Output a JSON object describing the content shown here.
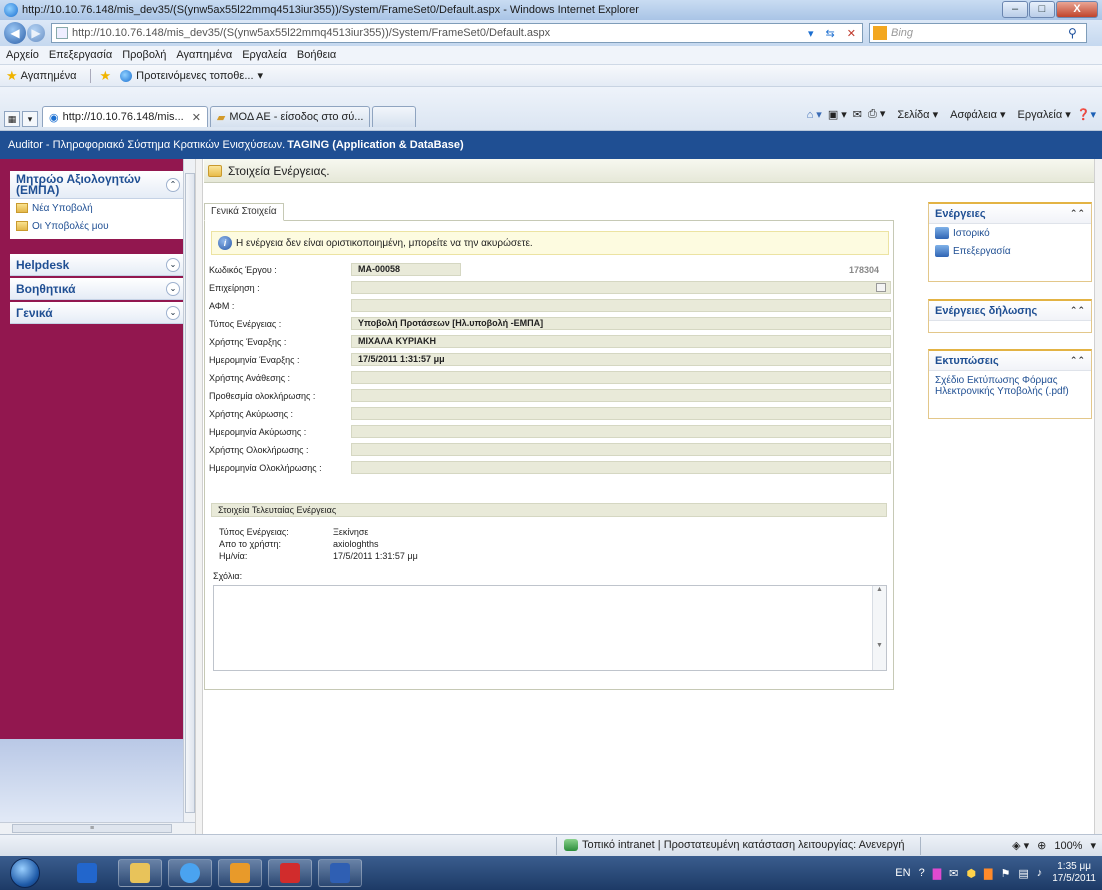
{
  "window": {
    "title": "http://10.10.76.148/mis_dev35/(S(ynw5ax55l22mmq4513iur355))/System/FrameSet0/Default.aspx - Windows Internet Explorer",
    "min": "‒",
    "max": "□",
    "close": "X"
  },
  "addressbar": {
    "url": "http://10.10.76.148/mis_dev35/(S(ynw5ax55l22mmq4513iur355))/System/FrameSet0/Default.aspx",
    "search_placeholder": "Bing"
  },
  "menubar": [
    "Αρχείο",
    "Επεξεργασία",
    "Προβολή",
    "Αγαπημένα",
    "Εργαλεία",
    "Βοήθεια"
  ],
  "favorites": {
    "label": "Αγαπημένα",
    "suggested": "Προτεινόμενες τοποθε..."
  },
  "tabs": [
    {
      "label": "http://10.10.76.148/mis..."
    },
    {
      "label": "ΜΟΔ ΑΕ - είσοδος στο σύ..."
    }
  ],
  "commandbar": {
    "page": "Σελίδα",
    "safety": "Ασφάλεια",
    "tools": "Εργαλεία"
  },
  "app": {
    "header_prefix": "Auditor - Πληροφοριακό Σύστημα Κρατικών Ενισχύσεων.",
    "header_bold": "TAGING (Application & DataBase)"
  },
  "sidebar": {
    "section1_title": "Μητρώο Αξιολογητών (ΕΜΠΑ)",
    "items": [
      "Νέα Υποβολή",
      "Οι Υποβολές μου"
    ],
    "helpdesk": "Helpdesk",
    "helpers": "Βοηθητικά",
    "general": "Γενικά"
  },
  "main": {
    "title": "Στοιχεία Ενέργειας.",
    "tab": "Γενικά Στοιχεία",
    "notice": "Η ενέργεια δεν είναι οριστικοποιημένη, μπορείτε να την ακυρώσετε.",
    "fields": [
      {
        "label": "Κωδικός Έργου :",
        "value": "MA-00058"
      },
      {
        "label": "Επιχείρηση :",
        "value": ""
      },
      {
        "label": "ΑΦΜ :",
        "value": ""
      },
      {
        "label": "Τύπος Ενέργειας :",
        "value": "Υποβολή Προτάσεων [Ηλ.υποβολή -ΕΜΠΑ]"
      },
      {
        "label": "Χρήστης Έναρξης :",
        "value": "ΜΙΧΑΛΑ ΚΥΡΙΑΚΗ"
      },
      {
        "label": "Ημερομηνία Έναρξης :",
        "value": "17/5/2011 1:31:57 μμ"
      },
      {
        "label": "Χρήστης Ανάθεσης :",
        "value": ""
      },
      {
        "label": "Προθεσμία ολοκλήρωσης :",
        "value": ""
      },
      {
        "label": "Χρήστης Ακύρωσης :",
        "value": ""
      },
      {
        "label": "Ημερομηνία Ακύρωσης :",
        "value": ""
      },
      {
        "label": "Χρήστης Ολοκλήρωσης :",
        "value": ""
      },
      {
        "label": "Ημερομηνία Ολοκλήρωσης :",
        "value": ""
      }
    ],
    "code_number": "178304",
    "last_title": "Στοιχεία Τελευταίας Ενέργειας",
    "last": [
      {
        "label": "Τύπος Ενέργειας:",
        "value": "Ξεκίνησε"
      },
      {
        "label": "Απο το χρήστη:",
        "value": "axiologhths"
      },
      {
        "label": "Ημ/νία:",
        "value": "17/5/2011 1:31:57 μμ"
      }
    ],
    "comments_label": "Σχόλια:"
  },
  "right": {
    "actions_title": "Ενέργειες",
    "actions": [
      "Ιστορικό",
      "Επεξεργασία"
    ],
    "declare_title": "Ενέργειες δήλωσης",
    "prints_title": "Εκτυπώσεις",
    "print_link": "Σχέδιο Εκτύπωσης Φόρμας Ηλεκτρονικής Υποβολής (.pdf)"
  },
  "statusbar": {
    "zone": "Τοπικό intranet | Προστατευμένη κατάσταση λειτουργίας: Ανενεργή",
    "zoom": "100%"
  },
  "taskbar": {
    "lang": "EN",
    "time": "1:35 μμ",
    "date": "17/5/2011"
  },
  "colors": {
    "sidebar": "#92174f",
    "header": "#1f4f93",
    "accent": "#e3b344"
  }
}
